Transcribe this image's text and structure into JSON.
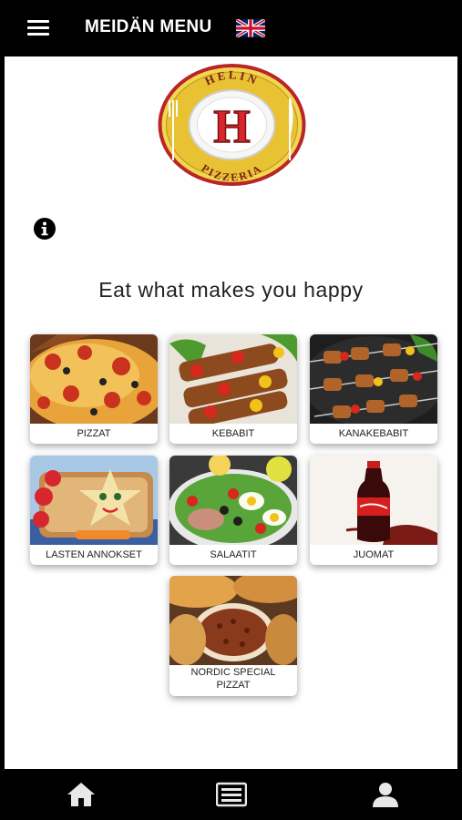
{
  "header": {
    "title": "MEIDÄN MENU",
    "menu_icon": "hamburger-icon",
    "language_icon": "uk-flag-icon"
  },
  "logo": {
    "top_text": "HELIN",
    "letter": "H",
    "bottom_text": "PIZZERIA"
  },
  "info_icon": "info-icon",
  "tagline": "Eat what makes you happy",
  "categories": [
    {
      "label": "PIZZAT"
    },
    {
      "label": "KEBABIT"
    },
    {
      "label": "KANAKEBABIT"
    },
    {
      "label": "LASTEN ANNOKSET"
    },
    {
      "label": "SALAATIT"
    },
    {
      "label": "JUOMAT"
    },
    {
      "label": "NORDIC SPECIAL PIZZAT"
    }
  ],
  "bottom_nav": {
    "items": [
      "home-icon",
      "menu-list-icon",
      "user-icon"
    ]
  },
  "colors": {
    "bar": "#000000",
    "logo_gold": "#e8c232",
    "logo_red": "#d8262e"
  }
}
